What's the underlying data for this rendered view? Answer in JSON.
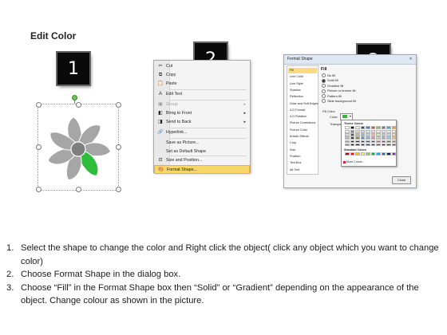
{
  "title": "Edit Color",
  "badges": [
    "1",
    "2",
    "3"
  ],
  "colors": {
    "fan_gray": "#a6a6a6",
    "fan_dark": "#7f7f7f",
    "fan_green": "#2ebd3a",
    "highlight": "#f7d768"
  },
  "context_menu": {
    "items": [
      {
        "label": "Cut",
        "icon": "scissors-icon",
        "glyph": "✂",
        "disabled": false,
        "submenu": false
      },
      {
        "label": "Copy",
        "icon": "copy-icon",
        "glyph": "⧉",
        "disabled": false,
        "submenu": false
      },
      {
        "label": "Paste",
        "icon": "paste-icon",
        "glyph": "📋",
        "disabled": false,
        "submenu": false
      },
      {
        "label": "Edit Text",
        "icon": "edit-text-icon",
        "glyph": "A",
        "disabled": false,
        "submenu": false
      },
      {
        "label": "Group",
        "icon": "group-icon",
        "glyph": "▣",
        "disabled": true,
        "submenu": true
      },
      {
        "label": "Bring to Front",
        "icon": "bring-front-icon",
        "glyph": "◧",
        "disabled": false,
        "submenu": true
      },
      {
        "label": "Send to Back",
        "icon": "send-back-icon",
        "glyph": "◨",
        "disabled": false,
        "submenu": true
      },
      {
        "label": "Hyperlink...",
        "icon": "hyperlink-icon",
        "glyph": "🔗",
        "disabled": false,
        "submenu": false
      },
      {
        "label": "Save as Picture...",
        "icon": "",
        "glyph": "",
        "disabled": false,
        "submenu": false
      },
      {
        "label": "Set as Default Shape",
        "icon": "",
        "glyph": "",
        "disabled": false,
        "submenu": false
      },
      {
        "label": "Size and Position...",
        "icon": "size-position-icon",
        "glyph": "⊡",
        "disabled": false,
        "submenu": false
      },
      {
        "label": "Format Shape...",
        "icon": "format-shape-icon",
        "glyph": "🎨",
        "disabled": false,
        "submenu": false,
        "highlighted": true
      }
    ]
  },
  "format_dialog": {
    "title": "Format Shape",
    "close_glyph": "✕",
    "nav": [
      "Fill",
      "Line Color",
      "Line Style",
      "Shadow",
      "Reflection",
      "Glow and Soft Edges",
      "3-D Format",
      "3-D Rotation",
      "Picture Corrections",
      "Picture Color",
      "Artistic Effects",
      "Crop",
      "Size",
      "Position",
      "Text Box",
      "Alt Text"
    ],
    "fill_heading": "Fill",
    "options": [
      {
        "label": "No fill",
        "selected": false
      },
      {
        "label": "Solid fill",
        "selected": true
      },
      {
        "label": "Gradient fill",
        "selected": false
      },
      {
        "label": "Picture or texture fill",
        "selected": false
      },
      {
        "label": "Pattern fill",
        "selected": false
      },
      {
        "label": "Slide background fill",
        "selected": false
      }
    ],
    "fill_color_label": "Fill Color",
    "color_label": "Color:",
    "transparency_label": "Transpa",
    "picker": {
      "theme_label": "Theme Colors",
      "standard_label": "Standard Colors",
      "more_label": "More Colors...",
      "theme_top": [
        "#ffffff",
        "#000000",
        "#eeece1",
        "#1f497d",
        "#4f81bd",
        "#c0504d",
        "#9bbb59",
        "#8064a2",
        "#4bacc6",
        "#f79646"
      ],
      "theme_tints": [
        [
          "#f2f2f2",
          "#7f7f7f",
          "#ddd9c3",
          "#c6d9f0",
          "#dbe5f1",
          "#f2dcdb",
          "#ebf1dd",
          "#e5e0ec",
          "#dbeef3",
          "#fdeada"
        ],
        [
          "#d8d8d8",
          "#595959",
          "#c4bd97",
          "#8db3e2",
          "#b8cce4",
          "#e5b9b7",
          "#d7e3bc",
          "#ccc1d9",
          "#b7dde8",
          "#fbd5b5"
        ],
        [
          "#bfbfbf",
          "#3f3f3f",
          "#938953",
          "#548dd4",
          "#95b3d7",
          "#d99694",
          "#c3d69b",
          "#b2a2c7",
          "#92cddc",
          "#fac08f"
        ],
        [
          "#a5a5a5",
          "#262626",
          "#494429",
          "#17365d",
          "#366092",
          "#953734",
          "#76923c",
          "#5f497a",
          "#31859b",
          "#e36c09"
        ],
        [
          "#7f7f7f",
          "#0c0c0c",
          "#1d1b10",
          "#0f243e",
          "#244061",
          "#632423",
          "#4f6128",
          "#3f3151",
          "#205867",
          "#974806"
        ]
      ],
      "standard": [
        "#c00000",
        "#ff0000",
        "#ffc000",
        "#ffff00",
        "#92d050",
        "#00b050",
        "#00b0f0",
        "#0070c0",
        "#002060",
        "#7030a0"
      ]
    },
    "close_button": "Close"
  },
  "steps": [
    {
      "num": "1.",
      "text": "Select the shape to change the color and Right click the object( click any object which you want to change color)"
    },
    {
      "num": "2.",
      "text": "Choose Format Shape in the dialog box."
    },
    {
      "num": "3.",
      "text": "Choose “Fill” in the Format Shape box then “Solid” or “Gradient” depending on the appearance of the object. Change colour as shown in the picture."
    }
  ]
}
